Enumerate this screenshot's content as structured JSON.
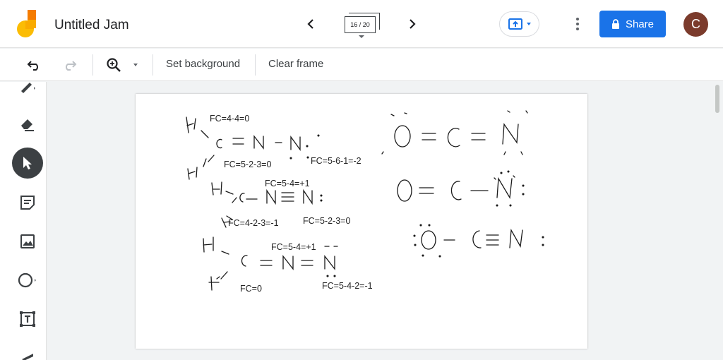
{
  "app": {
    "title": "Untitled Jam",
    "frame_counter": "16 / 20",
    "share_label": "Share",
    "avatar_initial": "C"
  },
  "toolbar": {
    "set_background": "Set background",
    "clear_frame": "Clear frame"
  },
  "canvas": {
    "annotations": [
      "FC=4-4=0",
      "FC=5-2-3=0",
      "FC=5-6-1=-2",
      "FC=5-4=+1",
      "FC=4-2-3=-1",
      "FC=5-2-3=0",
      "FC=5-4=+1",
      "FC=0",
      "FC=5-4-2=-1"
    ]
  },
  "colors": {
    "accent": "#1a73e8",
    "avatar": "#7b3b2c",
    "logo_orange": "#f9ab00",
    "logo_yellow": "#fbbc04"
  }
}
